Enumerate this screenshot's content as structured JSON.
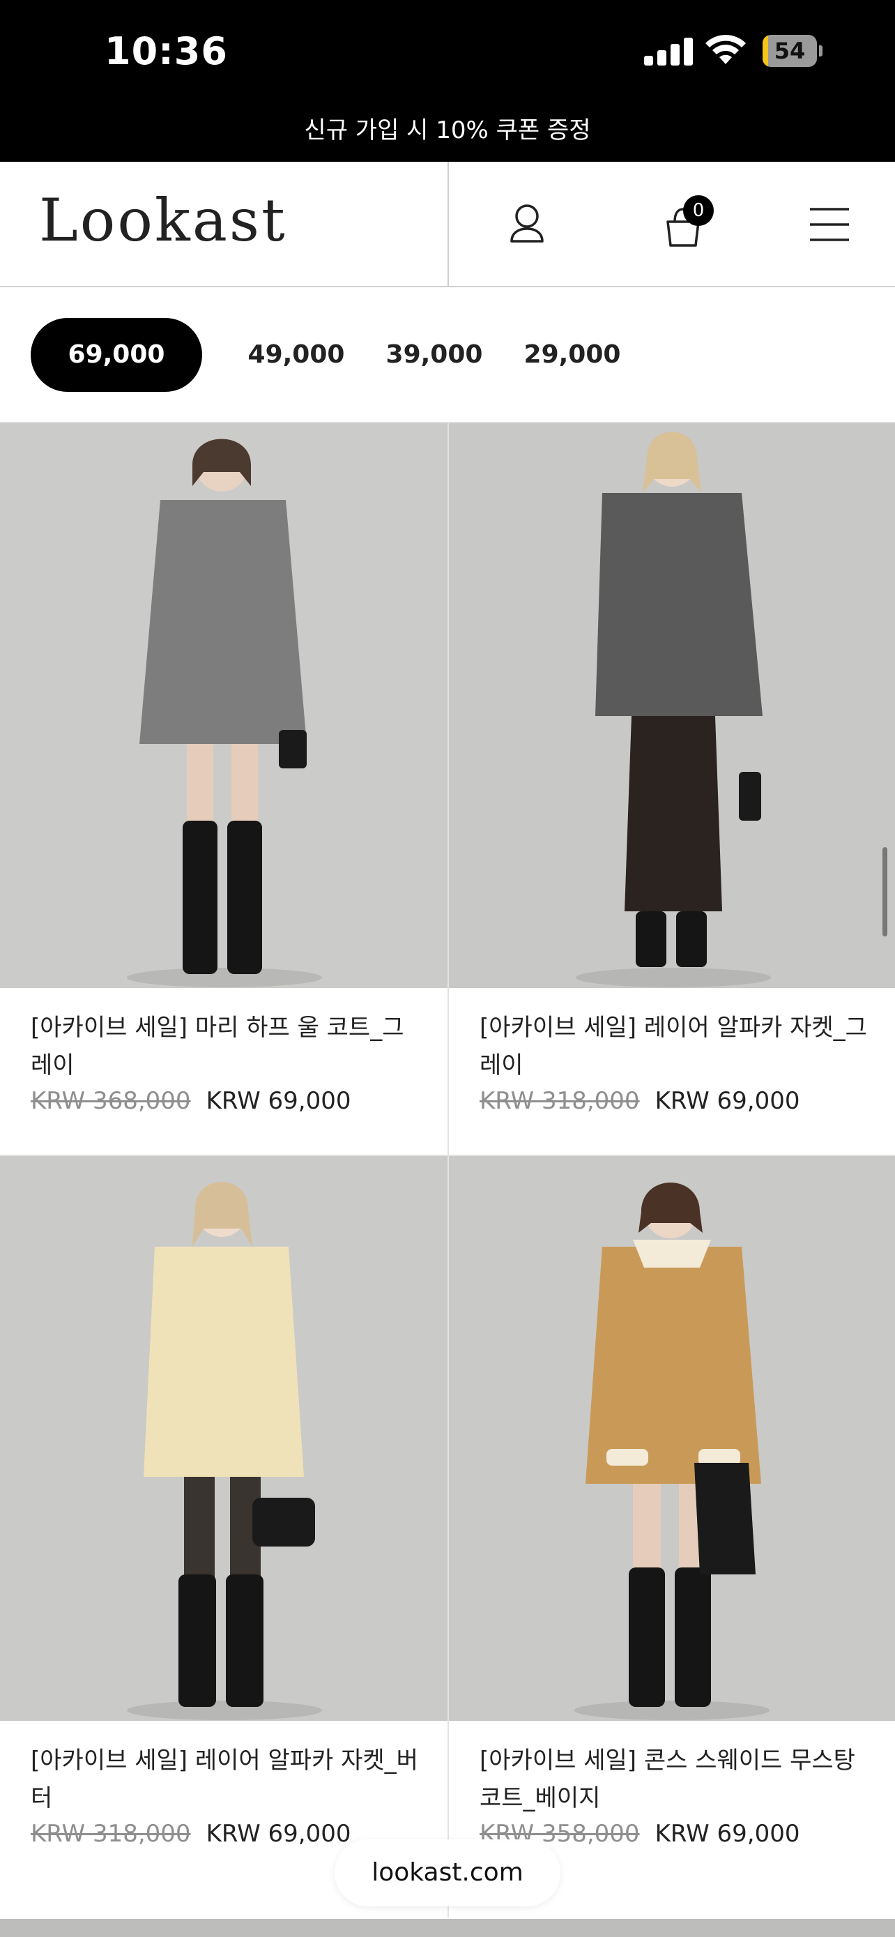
{
  "status_bar": {
    "time": "10:36",
    "battery": "54"
  },
  "promo": {
    "text": "신규 가입 시 10% 쿠폰 증정"
  },
  "header": {
    "logo": "Lookast",
    "cart_count": "0"
  },
  "filters": [
    {
      "label": "69,000",
      "active": true
    },
    {
      "label": "49,000",
      "active": false
    },
    {
      "label": "39,000",
      "active": false
    },
    {
      "label": "29,000",
      "active": false
    }
  ],
  "products": [
    {
      "name": "[아카이브 세일] 마리 하프 울 코트_그레이",
      "old_price": "KRW 368,000",
      "price": "KRW 69,000",
      "coat_color": "#7d7d7d"
    },
    {
      "name": "[아카이브 세일] 레이어 알파카 자켓_그레이",
      "old_price": "KRW 318,000",
      "price": "KRW 69,000",
      "coat_color": "#5a5a5a"
    },
    {
      "name": "[아카이브 세일] 레이어 알파카 자켓_버터",
      "old_price": "KRW 318,000",
      "price": "KRW 69,000",
      "coat_color": "#efe2b8"
    },
    {
      "name": "[아카이브 세일] 콘스 스웨이드 무스탕 코트_베이지",
      "old_price": "KRW 358,000",
      "price": "KRW 69,000",
      "coat_color": "#c99a57"
    }
  ],
  "browser": {
    "url": "lookast.com"
  }
}
